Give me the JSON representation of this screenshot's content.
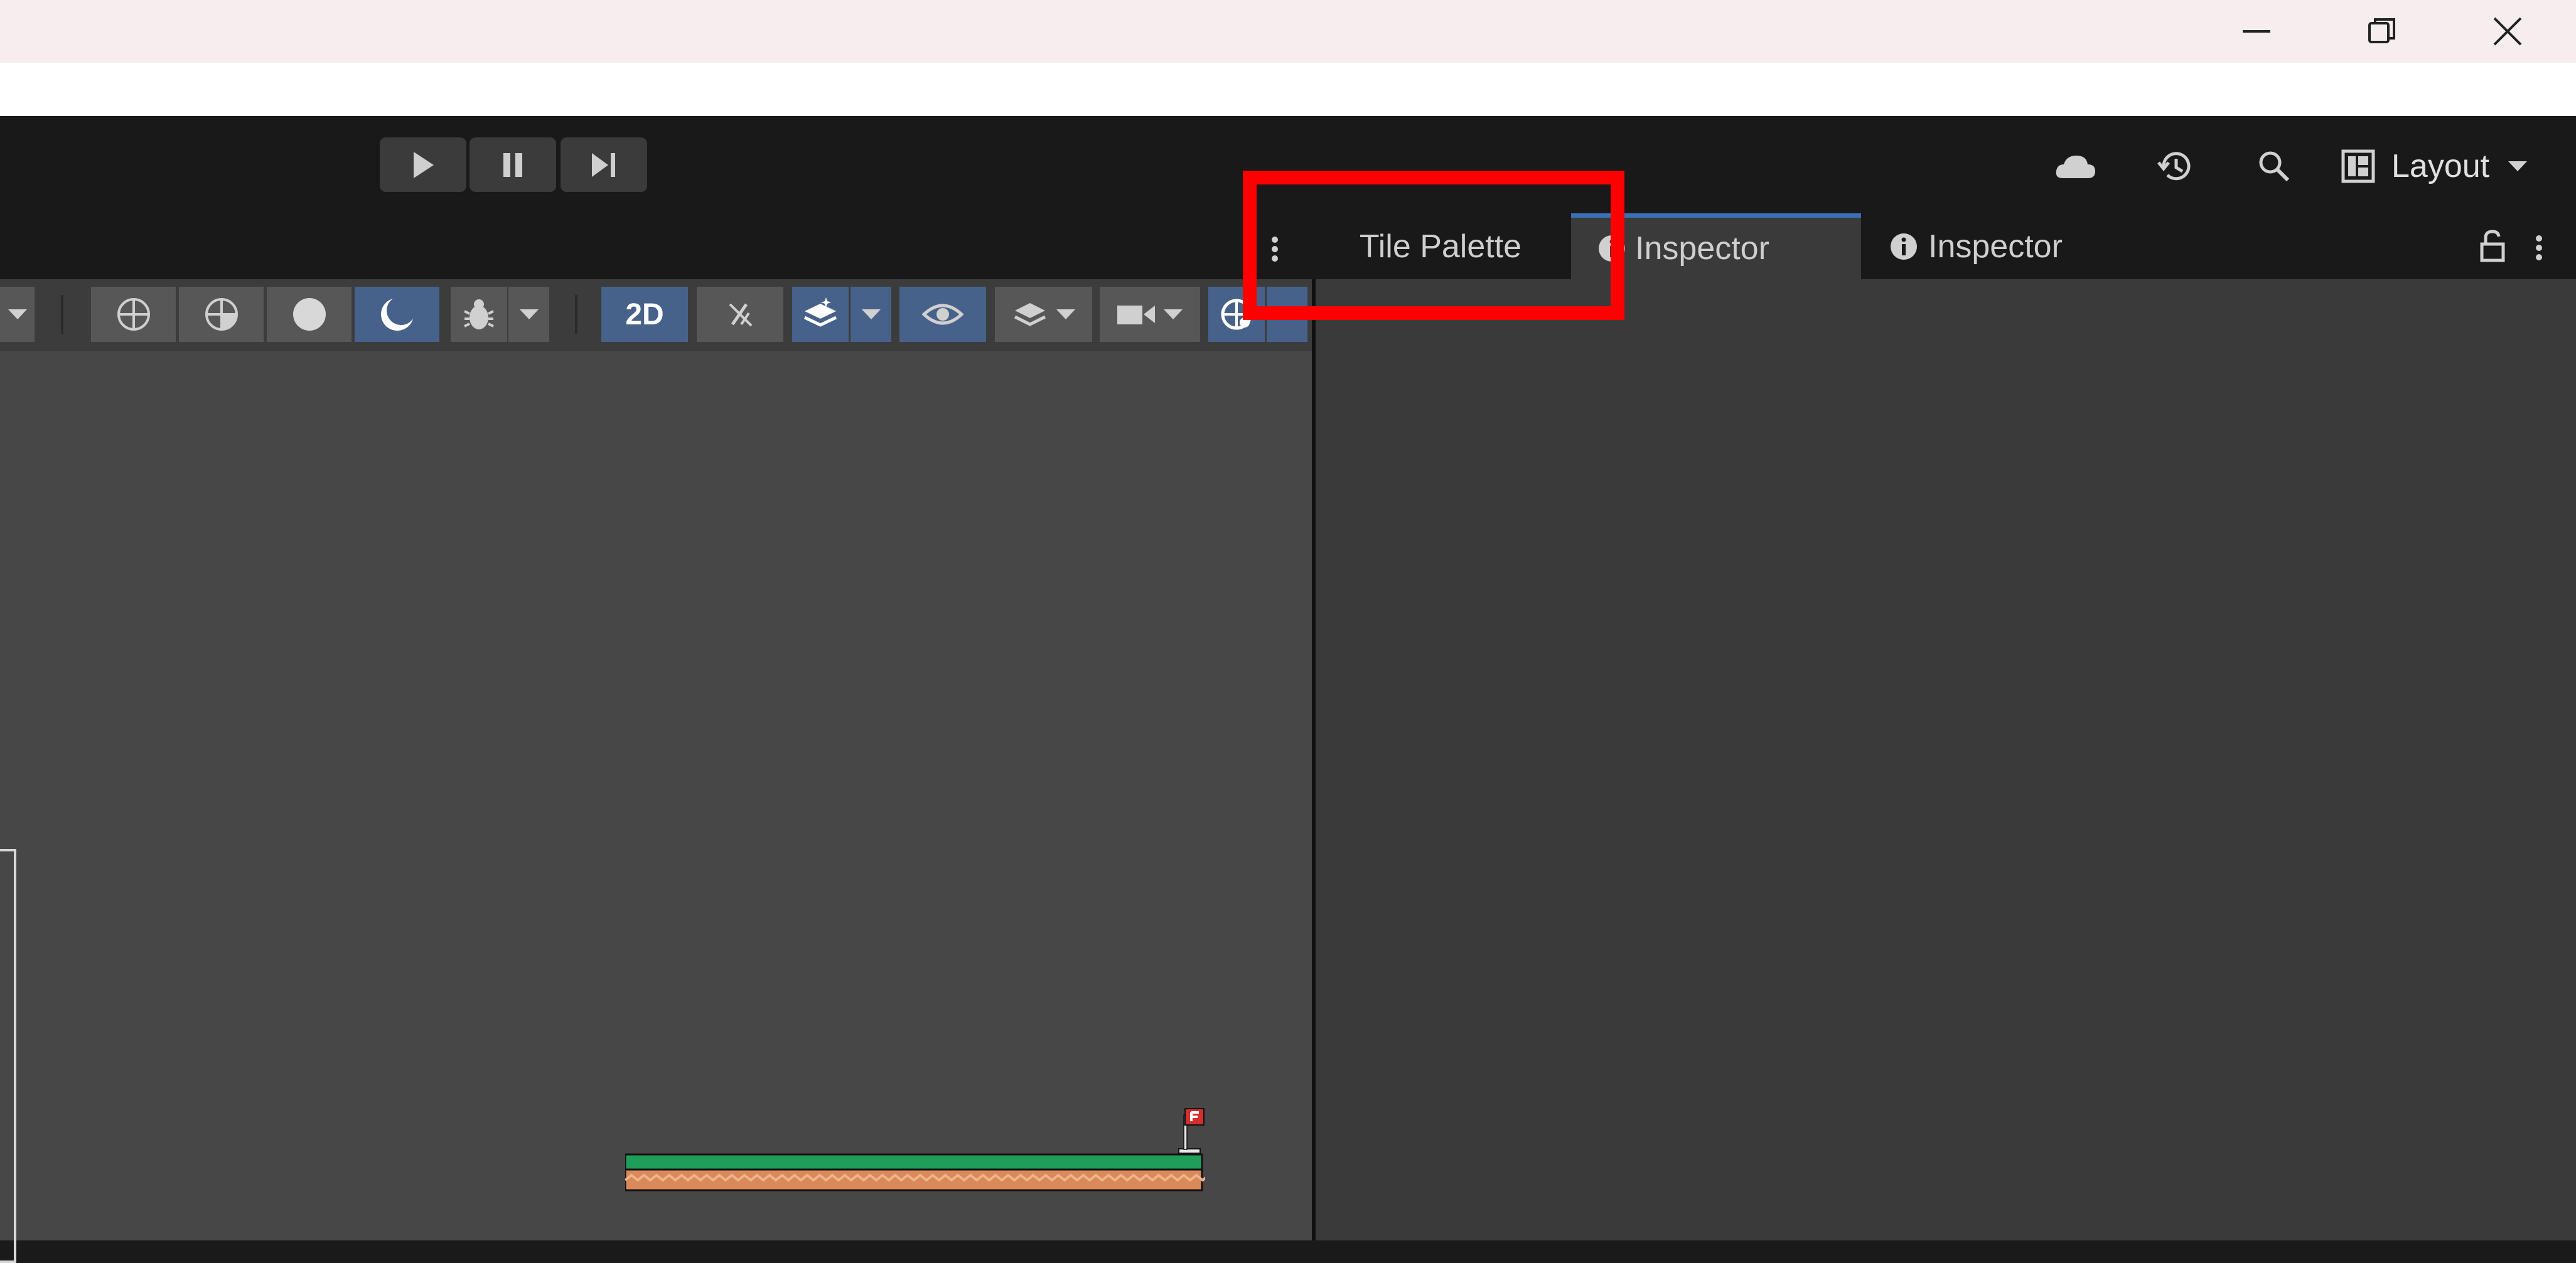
{
  "window": {
    "minimize_icon": "minimize-icon",
    "maximize_icon": "restore-icon",
    "close_icon": "close-icon"
  },
  "toolbar": {
    "play_icon": "play-icon",
    "pause_icon": "pause-icon",
    "step_icon": "step-icon",
    "cloud_icon": "cloud-icon",
    "history_icon": "history-icon",
    "search_icon": "search-icon",
    "layout_label": "Layout"
  },
  "tabs": [
    {
      "label": "Tile Palette",
      "active": false
    },
    {
      "label": "Inspector",
      "active": true
    },
    {
      "label": "Inspector",
      "active": false
    }
  ],
  "scene_toolbar": {
    "mode_2d_label": "2D",
    "shading_modes": [
      "wireframe",
      "shaded-wireframe",
      "shaded",
      "unlit"
    ],
    "active_shading": "unlit"
  },
  "colors": {
    "accent": "#47628a",
    "tab_active_underline": "#3b6fb6",
    "highlight": "#ff0000",
    "grass": "#1f9e5a",
    "dirt": "#d9895a"
  }
}
